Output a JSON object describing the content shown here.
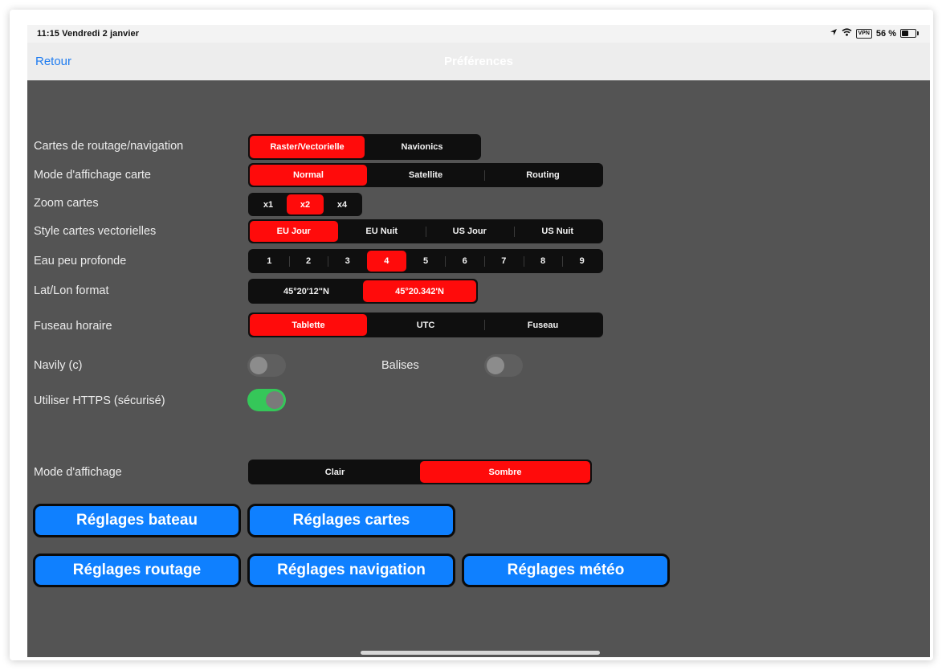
{
  "status": {
    "time": "11:15  Vendredi 2 janvier",
    "vpn": "VPN",
    "battery": "56 %",
    "battery_level": 0.56
  },
  "nav": {
    "back": "Retour",
    "title": "Préférences"
  },
  "settings": {
    "charts": {
      "label": "Cartes de routage/navigation",
      "options": [
        "Raster/Vectorielle",
        "Navionics"
      ],
      "selected": 0
    },
    "display_map": {
      "label": "Mode d'affichage carte",
      "options": [
        "Normal",
        "Satellite",
        "Routing"
      ],
      "selected": 0
    },
    "zoom": {
      "label": "Zoom cartes",
      "options": [
        "x1",
        "x2",
        "x4"
      ],
      "selected": 1
    },
    "vector_style": {
      "label": "Style cartes vectorielles",
      "options": [
        "EU Jour",
        "EU Nuit",
        "US Jour",
        "US Nuit"
      ],
      "selected": 0
    },
    "shallow": {
      "label": "Eau peu profonde",
      "options": [
        "1",
        "2",
        "3",
        "4",
        "5",
        "6",
        "7",
        "8",
        "9"
      ],
      "selected": 3
    },
    "latlon": {
      "label": "Lat/Lon format",
      "options": [
        "45°20'12\"N",
        "45°20.342'N"
      ],
      "selected": 1
    },
    "timezone": {
      "label": "Fuseau horaire",
      "options": [
        "Tablette",
        "UTC",
        "Fuseau"
      ],
      "selected": 0
    },
    "navily": {
      "label": "Navily (c)",
      "on": false
    },
    "balises": {
      "label": "Balises",
      "on": false
    },
    "https": {
      "label": "Utiliser HTTPS (sécurisé)",
      "on": true
    },
    "display_mode": {
      "label": "Mode d'affichage",
      "options": [
        "Clair",
        "Sombre"
      ],
      "selected": 1
    }
  },
  "buttons": {
    "boat": "Réglages bateau",
    "charts": "Réglages cartes",
    "routing": "Réglages routage",
    "navigation": "Réglages navigation",
    "weather": "Réglages météo"
  },
  "colors": {
    "selected": "#ff0b0b",
    "button": "#0f80ff",
    "toggle_on": "#35c759",
    "background": "#545454",
    "link": "#1f7cf0"
  }
}
